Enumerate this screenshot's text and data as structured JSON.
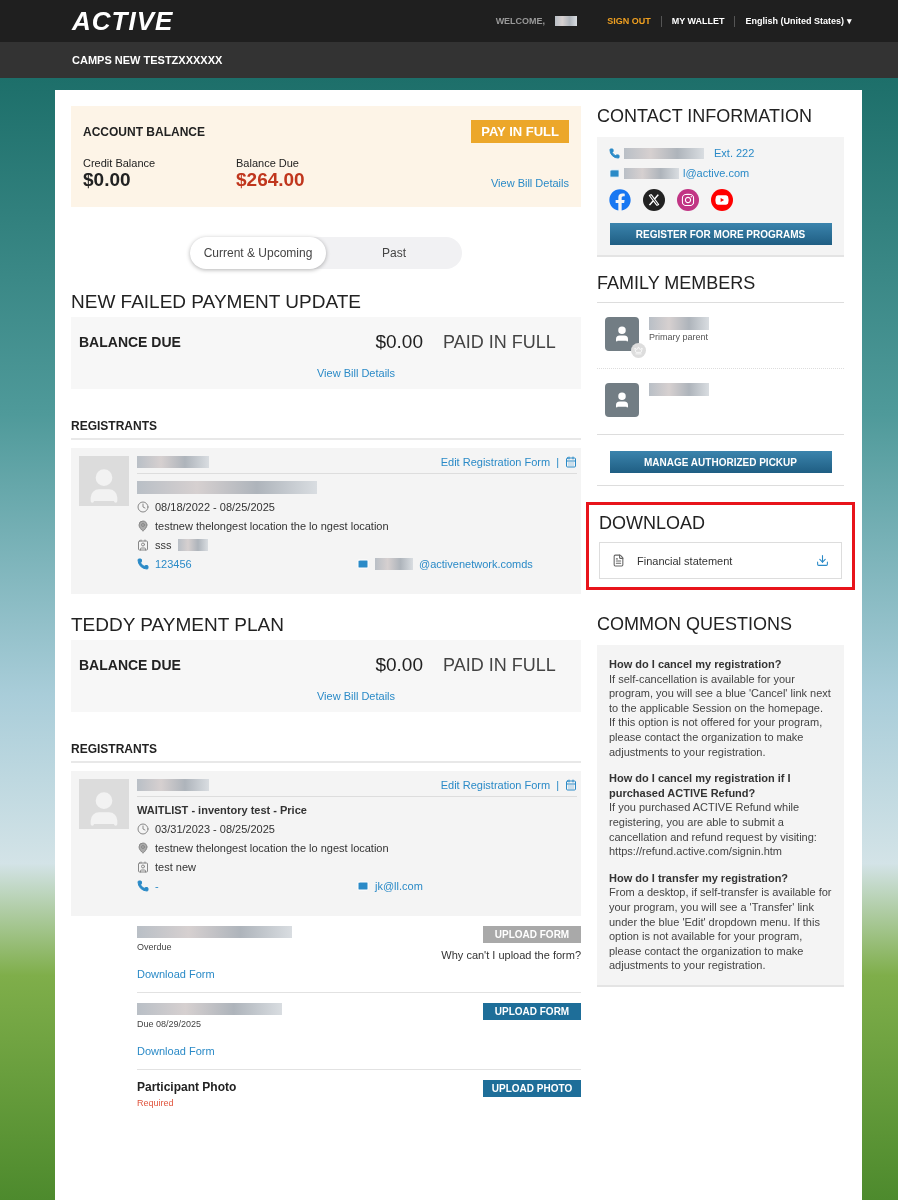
{
  "header": {
    "logo": "ACTIVE",
    "welcome": "WELCOME,",
    "sign_out": "SIGN OUT",
    "wallet": "MY WALLET",
    "language": "English (United States)",
    "language_caret": "▾"
  },
  "subheader": {
    "title": "CAMPS NEW TESTZXXXXXX"
  },
  "account_balance": {
    "title": "ACCOUNT BALANCE",
    "pay_button": "PAY IN FULL",
    "credit_label": "Credit Balance",
    "credit_value": "$0.00",
    "due_label": "Balance Due",
    "due_value": "$264.00",
    "link": "View Bill Details"
  },
  "tabs": [
    {
      "label": "Current & Upcoming",
      "selected": true
    },
    {
      "label": "Past",
      "selected": false
    }
  ],
  "programs": [
    {
      "title": "NEW FAILED PAYMENT UPDATE",
      "balance_label": "BALANCE DUE",
      "amount": "$0.00",
      "status": "PAID IN FULL",
      "link": "View Bill Details",
      "registrants_heading": "REGISTRANTS",
      "registrant": {
        "edit_link": "Edit Registration Form",
        "separator": "|",
        "date": "08/18/2022 - 08/25/2025",
        "location": "testnew thelongest location the lo ngest location",
        "group": "sss",
        "phone": "123456",
        "email": "@activenetwork.comds"
      }
    },
    {
      "title": "TEDDY PAYMENT PLAN",
      "balance_label": "BALANCE DUE",
      "amount": "$0.00",
      "status": "PAID IN FULL",
      "link": "View Bill Details",
      "registrants_heading": "REGISTRANTS",
      "registrant": {
        "edit_link": "Edit Registration Form",
        "separator": "|",
        "session": "WAITLIST - inventory test - Price",
        "date": "03/31/2023 - 08/25/2025",
        "location": "testnew thelongest location the lo ngest location",
        "group": "test new",
        "phone": "-",
        "email": "jk@ll.com"
      },
      "forms": [
        {
          "kind": "form",
          "status": "Overdue",
          "button": "UPLOAD FORM",
          "disabled": true,
          "note": "Why can't I upload the form?",
          "link": "Download Form"
        },
        {
          "kind": "form",
          "status": "Due 08/29/2025",
          "button": "UPLOAD FORM",
          "disabled": false,
          "link": "Download Form"
        },
        {
          "kind": "photo",
          "title": "Participant Photo",
          "status": "Required",
          "button": "UPLOAD PHOTO",
          "disabled": false
        }
      ]
    }
  ],
  "contact": {
    "title": "CONTACT INFORMATION",
    "phone_ext": "Ext. 222",
    "email": "l@active.com",
    "button": "REGISTER FOR MORE PROGRAMS"
  },
  "family": {
    "title": "FAMILY MEMBERS",
    "members": [
      {
        "role": "Primary parent",
        "primary": true
      },
      {
        "primary": false
      }
    ],
    "button": "MANAGE AUTHORIZED PICKUP"
  },
  "download": {
    "title": "DOWNLOAD",
    "highlighted": true,
    "item": "Financial statement"
  },
  "questions": {
    "title": "COMMON QUESTIONS",
    "items": [
      {
        "q": "How do I cancel my registration?",
        "a": "If self-cancellation is available for your program, you will see a blue 'Cancel' link next to the applicable Session on the homepage. If this option is not offered for your program, please contact the organization to make adjustments to your registration."
      },
      {
        "q": "How do I cancel my registration if I purchased ACTIVE Refund?",
        "a": "If you purchased ACTIVE Refund while registering, you are able to submit a cancellation and refund request by visiting: https://refund.active.com/signin.htm"
      },
      {
        "q": "How do I transfer my registration?",
        "a": "From a desktop, if self-transfer is available for your program, you will see a 'Transfer' link under the blue 'Edit' dropdown menu. If this option is not available for your program, please contact the organization to make adjustments to your registration."
      }
    ]
  }
}
